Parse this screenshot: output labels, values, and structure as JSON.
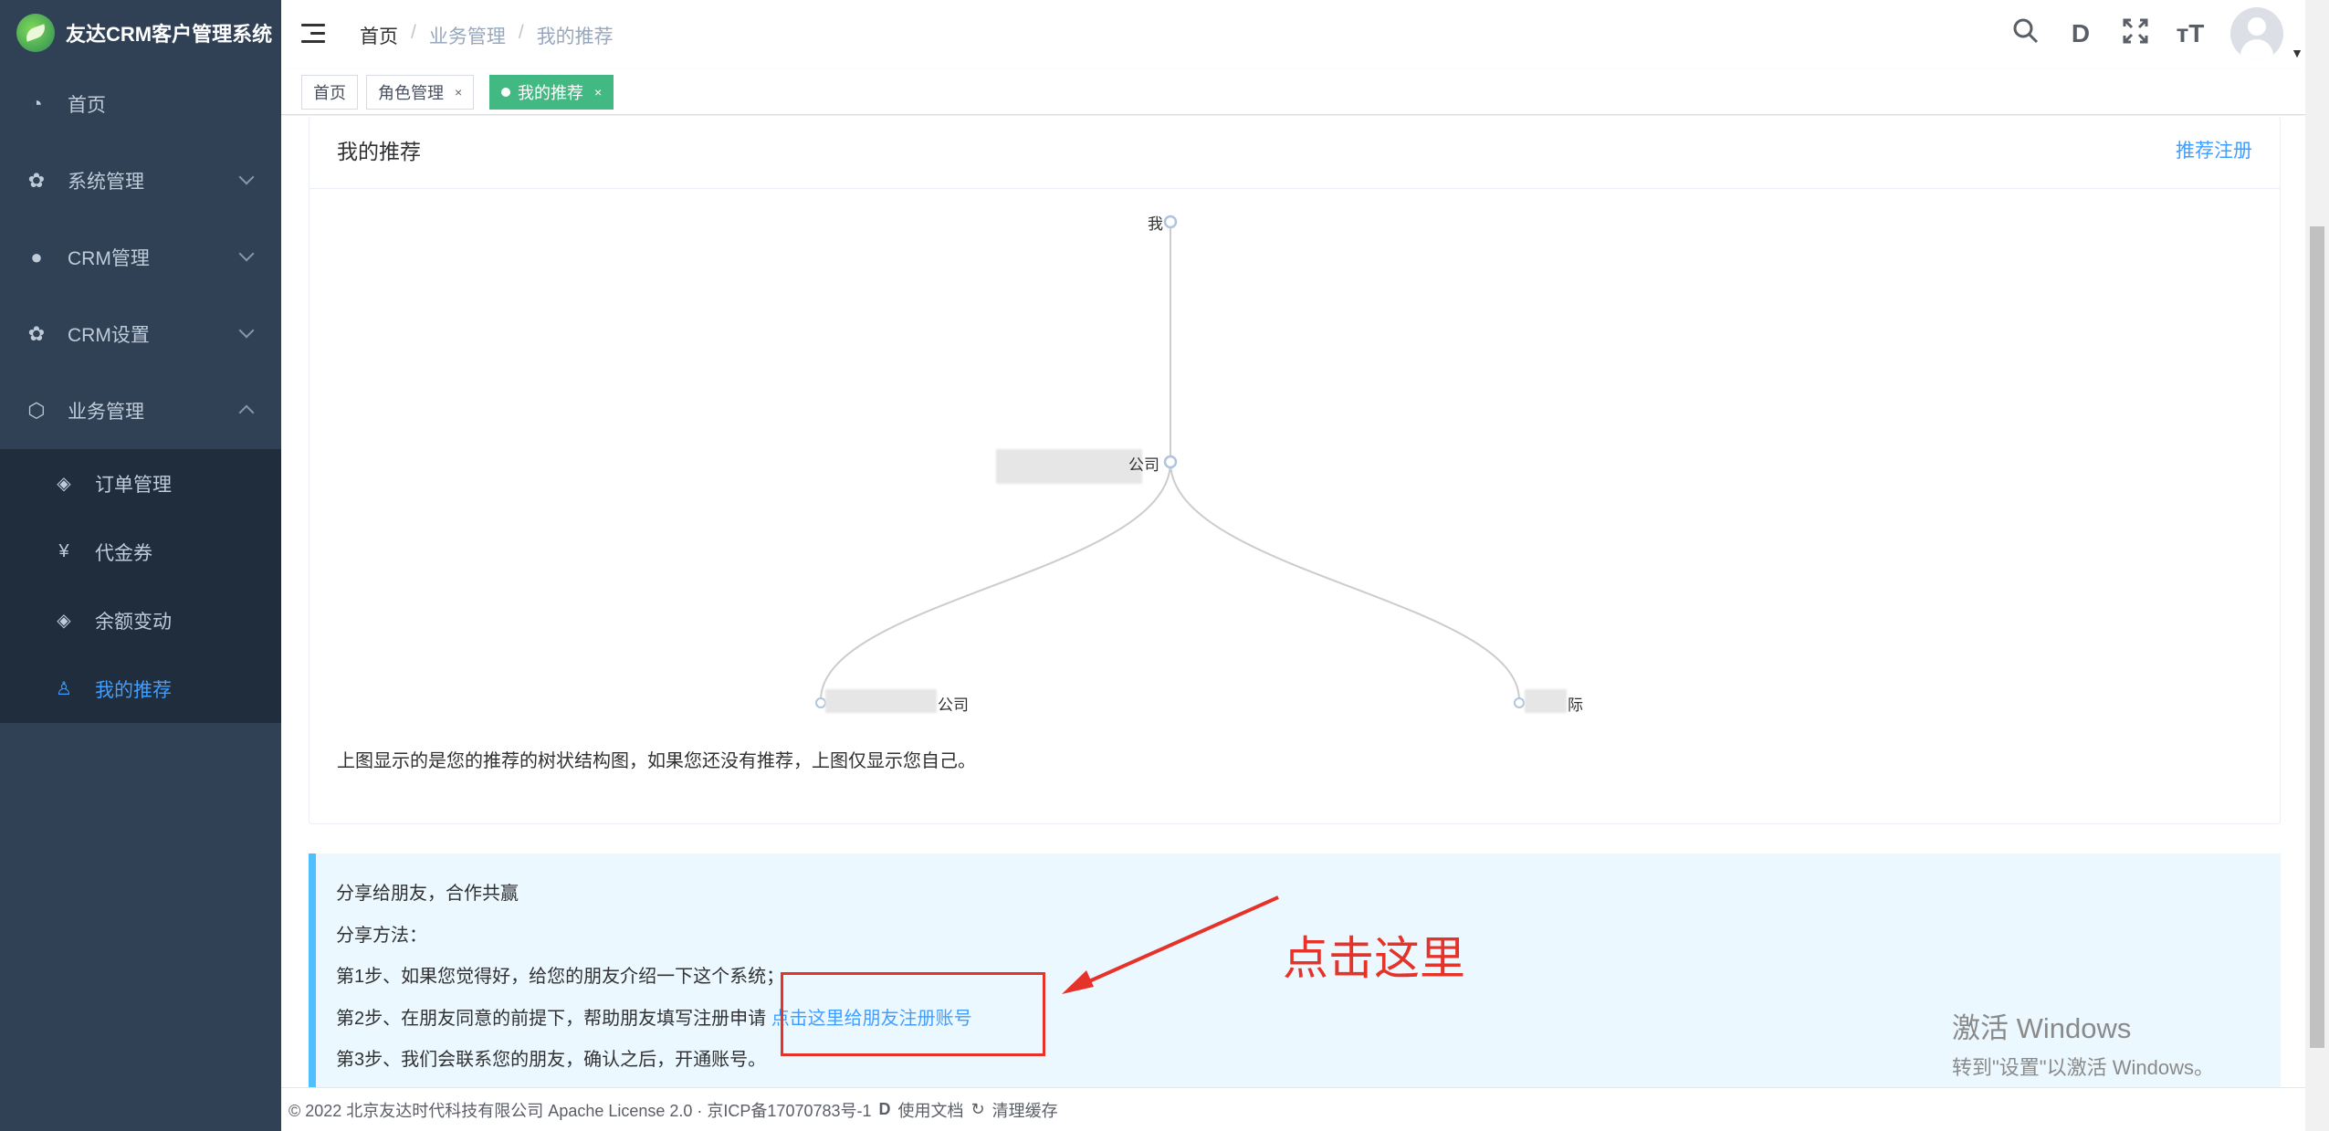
{
  "app": {
    "title": "友达CRM客户管理系统"
  },
  "sidebar": {
    "items": [
      {
        "label": "首页",
        "icon": "dashboard-icon"
      },
      {
        "label": "系统管理",
        "icon": "gear-icon"
      },
      {
        "label": "CRM管理",
        "icon": "wechat-icon"
      },
      {
        "label": "CRM设置",
        "icon": "gear-icon"
      },
      {
        "label": "业务管理",
        "icon": "cube-icon"
      }
    ],
    "sub_items": [
      {
        "label": "订单管理",
        "icon": "diamond-icon"
      },
      {
        "label": "代金券",
        "icon": "yen-icon"
      },
      {
        "label": "余额变动",
        "icon": "diamond-icon"
      },
      {
        "label": "我的推荐",
        "icon": "user-icon"
      }
    ]
  },
  "breadcrumb": {
    "home": "首页",
    "parent": "业务管理",
    "current": "我的推荐"
  },
  "tags": {
    "home": "首页",
    "role": "角色管理",
    "current": "我的推荐",
    "close": "×"
  },
  "card": {
    "title": "我的推荐",
    "link": "推荐注册",
    "tree": {
      "root": "我",
      "child": "公司",
      "leaf_left": "公司",
      "leaf_right": "际"
    },
    "description": "上图显示的是您的推荐的树状结构图，如果您还没有推荐，上图仅显示您自己。"
  },
  "tip": {
    "line1": "分享给朋友，合作共赢",
    "line2": "分享方法：",
    "line3": "第1步、如果您觉得好，给您的朋友介绍一下这个系统；",
    "line4": "第2步、在朋友同意的前提下，帮助朋友填写注册申请",
    "line4_link": "点击这里给朋友注册账号",
    "line5": "第3步、我们会联系您的朋友，确认之后，开通账号。"
  },
  "footer": {
    "copyright": "© 2022 北京友达时代科技有限公司 Apache License 2.0 · 京ICP备17070783号-1",
    "docs": "使用文档",
    "cache": "清理缓存"
  },
  "annotation": {
    "text": "点击这里"
  },
  "watermark": {
    "line1": "激活 Windows",
    "line2": "转到\"设置\"以激活 Windows。"
  },
  "colors": {
    "sidebar": "#304156",
    "submenu": "#1f2d3d",
    "active": "#409eff",
    "tag_active": "#42b983",
    "annotation": "#e53329"
  }
}
